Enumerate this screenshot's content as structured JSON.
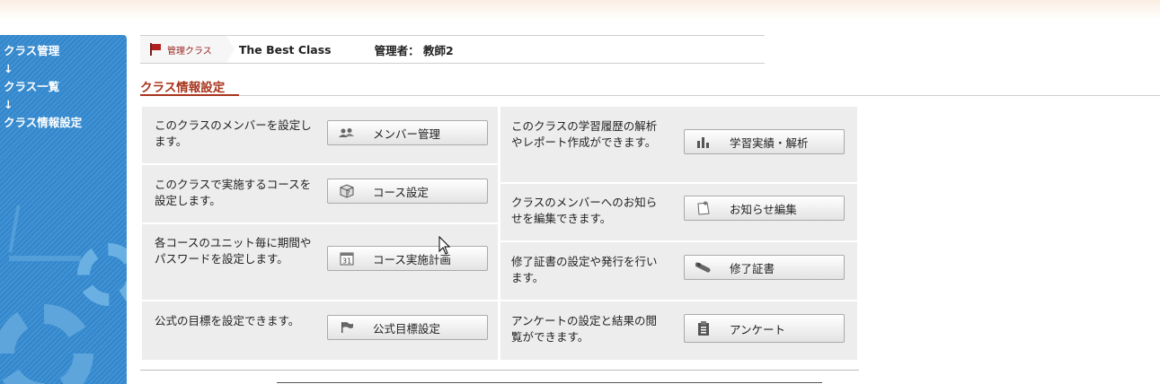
{
  "sidebar": {
    "breadcrumb": [
      "クラス管理",
      "↓",
      "クラス一覧",
      "↓",
      "クラス情報設定"
    ]
  },
  "header": {
    "tag_label": "管理クラス",
    "class_name": "The Best Class",
    "admin_label": "管理者： 教師2"
  },
  "section": {
    "title": "クラス情報設定"
  },
  "left_rows": [
    {
      "desc": "このクラスのメンバーを設定します。",
      "button": "メンバー管理",
      "icon": "users-icon"
    },
    {
      "desc": "このクラスで実施するコースを設定します。",
      "button": "コース設定",
      "icon": "course-box-icon"
    },
    {
      "desc": "各コースのユニット毎に期間やパスワードを設定します。",
      "button": "コース実施計画",
      "icon": "calendar-icon"
    },
    {
      "desc": "公式の目標を設定できます。",
      "button": "公式目標設定",
      "icon": "flag-icon"
    }
  ],
  "right_rows": [
    {
      "desc": "このクラスの学習履歴の解析やレポート作成ができます。",
      "button": "学習実績・解析",
      "icon": "bar-chart-icon"
    },
    {
      "desc": "クラスのメンバーへのお知らせを編集できます。",
      "button": "お知らせ編集",
      "icon": "note-icon"
    },
    {
      "desc": "修了証書の設定や発行を行います。",
      "button": "修了証書",
      "icon": "diploma-icon"
    },
    {
      "desc": "アンケートの設定と結果の閲覧ができます。",
      "button": "アンケート",
      "icon": "clipboard-icon"
    }
  ],
  "colors": {
    "accent": "#a8351c",
    "sidebar": "#3e93d6",
    "panel": "#ededed"
  }
}
